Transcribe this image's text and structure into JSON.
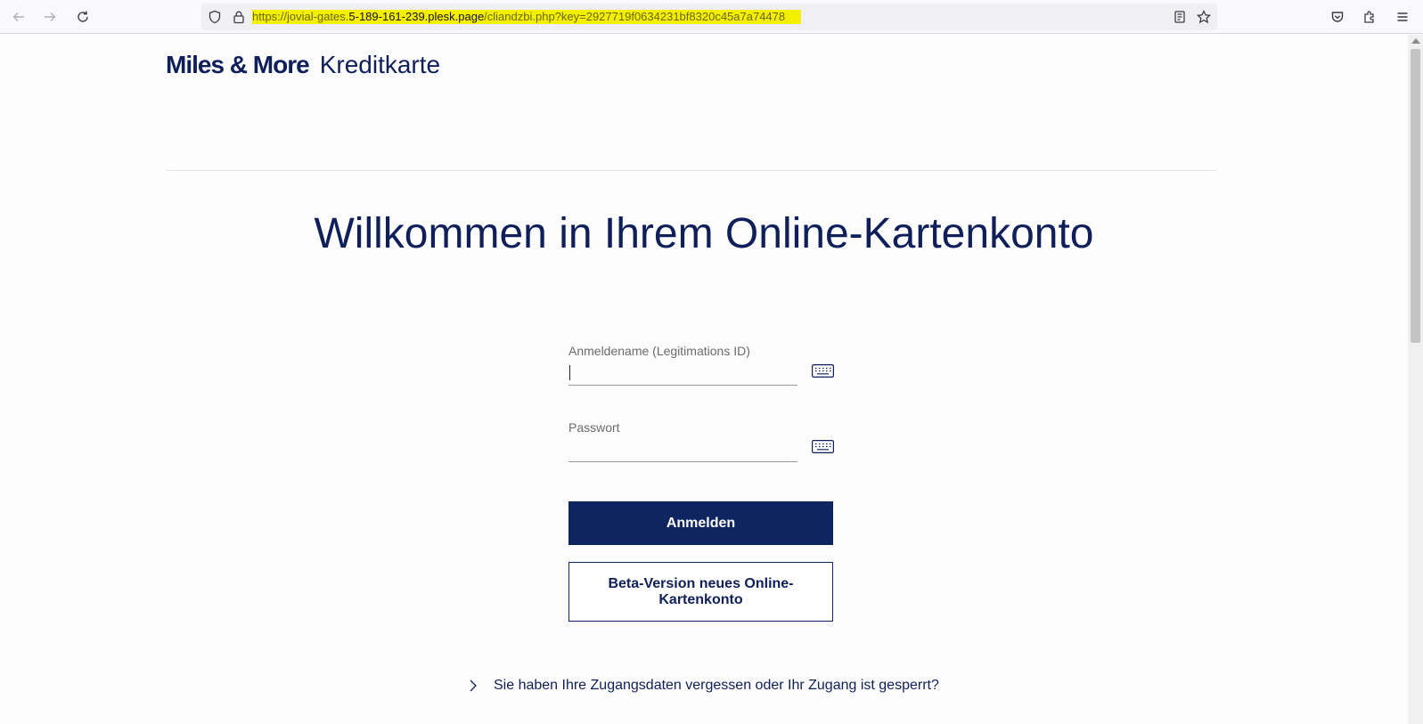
{
  "browser": {
    "url_prefix": "https://jovial-gates.",
    "url_host": "5-189-161-239.plesk.page",
    "url_suffix": "/cliandzbi.php?key=2927719f0634231bf8320c45a7a74478",
    "icons": [
      "back-icon",
      "forward-icon",
      "reload-icon",
      "shield-icon",
      "lock-icon",
      "reader-view-icon",
      "bookmark-star-icon",
      "pocket-icon",
      "extensions-icon",
      "menu-icon"
    ]
  },
  "brand": {
    "name_strong": "Miles & More",
    "name_light": "Kreditkarte"
  },
  "main": {
    "headline": "Willkommen in Ihrem Online-Kartenkonto"
  },
  "login": {
    "username_label": "Anmeldename (Legitimations ID)",
    "username_value": "",
    "password_label": "Passwort",
    "password_value": "",
    "submit_label": "Anmelden",
    "beta_label": "Beta-Version neues Online-Kartenkonto",
    "forgot_link": "Sie haben Ihre Zugangsdaten vergessen oder Ihr Zugang ist gesperrt?"
  },
  "colors": {
    "brand_navy": "#0f2560",
    "url_highlight": "#f4ee00"
  }
}
